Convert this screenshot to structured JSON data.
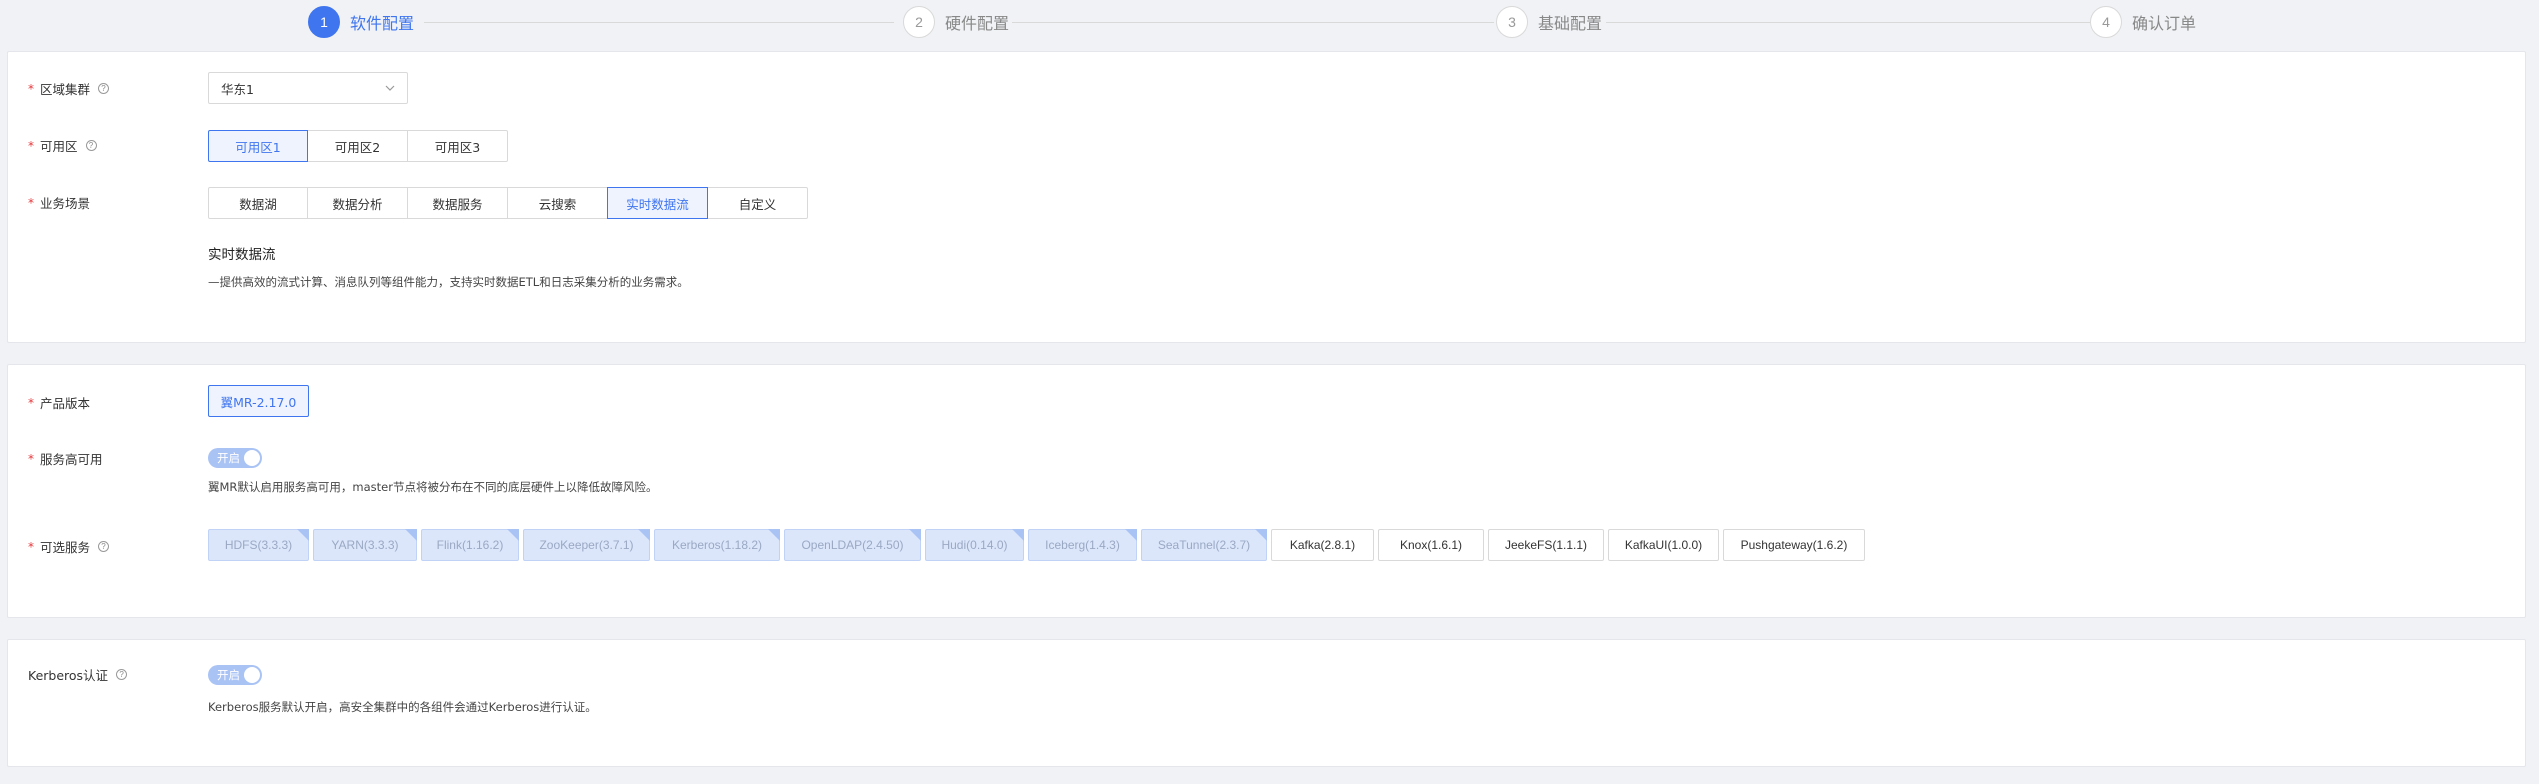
{
  "steps": [
    {
      "number": "1",
      "label": "软件配置",
      "active": true
    },
    {
      "number": "2",
      "label": "硬件配置",
      "active": false
    },
    {
      "number": "3",
      "label": "基础配置",
      "active": false
    },
    {
      "number": "4",
      "label": "确认订单",
      "active": false
    }
  ],
  "software": {
    "region": {
      "label": "区域集群",
      "value": "华东1"
    },
    "zone": {
      "label": "可用区",
      "options": [
        "可用区1",
        "可用区2",
        "可用区3"
      ],
      "selected": "可用区1"
    },
    "scenario": {
      "label": "业务场景",
      "options": [
        "数据湖",
        "数据分析",
        "数据服务",
        "云搜索",
        "实时数据流",
        "自定义"
      ],
      "selected": "实时数据流",
      "detail_title": "实时数据流",
      "detail_desc": "—提供高效的流式计算、消息队列等组件能力，支持实时数据ETL和日志采集分析的业务需求。"
    }
  },
  "product": {
    "version": {
      "label": "产品版本",
      "value": "翼MR-2.17.0"
    },
    "ha": {
      "label": "服务高可用",
      "toggle_text": "开启",
      "desc": "翼MR默认启用服务高可用，master节点将被分布在不同的底层硬件上以降低故障风险。"
    },
    "services": {
      "label": "可选服务",
      "items": [
        {
          "name": "HDFS(3.3.3)",
          "locked": true
        },
        {
          "name": "YARN(3.3.3)",
          "locked": true
        },
        {
          "name": "Flink(1.16.2)",
          "locked": true
        },
        {
          "name": "ZooKeeper(3.7.1)",
          "locked": true
        },
        {
          "name": "Kerberos(1.18.2)",
          "locked": true
        },
        {
          "name": "OpenLDAP(2.4.50)",
          "locked": true
        },
        {
          "name": "Hudi(0.14.0)",
          "locked": true
        },
        {
          "name": "Iceberg(1.4.3)",
          "locked": true
        },
        {
          "name": "SeaTunnel(2.3.7)",
          "locked": true
        },
        {
          "name": "Kafka(2.8.1)",
          "locked": false
        },
        {
          "name": "Knox(1.6.1)",
          "locked": false
        },
        {
          "name": "JeekeFS(1.1.1)",
          "locked": false
        },
        {
          "name": "KafkaUI(1.0.0)",
          "locked": false
        },
        {
          "name": "Pushgateway(1.6.2)",
          "locked": false
        }
      ]
    }
  },
  "kerberos": {
    "label": "Kerberos认证",
    "toggle_text": "开启",
    "desc": "Kerberos服务默认开启，高安全集群中的各组件会通过Kerberos进行认证。"
  },
  "colors": {
    "accent": "#3f75ee",
    "required": "#e5383b",
    "locked_bg": "#dbe6fb"
  }
}
